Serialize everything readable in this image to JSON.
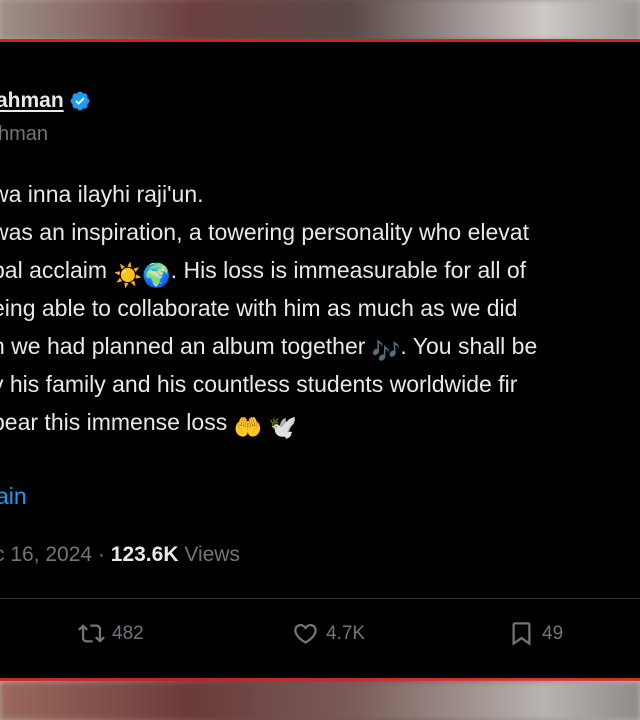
{
  "post": {
    "display_name": "ahman",
    "handle": "hman",
    "lines": [
      {
        "text": "wa inna ilayhi raji'un."
      },
      {
        "text": "was an inspiration, a towering personality who elevat"
      },
      {
        "text": "bal acclaim ",
        "emojis": [
          "☀️",
          "🌍"
        ],
        "after": ". His loss is immeasurable for all of"
      },
      {
        "text": "eing able to collaborate with him as much as we did"
      },
      {
        "text": "n we had planned an album together ",
        "emojis": [
          "🎶"
        ],
        "after": ". You shall be"
      },
      {
        "text": "y his family and his countless students worldwide fir"
      },
      {
        "text": "bear this immense loss ",
        "emojis": [
          "🤲",
          "🕊️"
        ],
        "after": ""
      }
    ],
    "show_more": "ain",
    "date": "c 16, 2024",
    "separator": " · ",
    "views_count": "123.6K",
    "views_label": " Views"
  },
  "actions": {
    "retweets": "482",
    "likes": "4.7K",
    "bookmarks": "49"
  },
  "colors": {
    "background": "#000000",
    "text": "#e7e9ea",
    "muted": "#71767b",
    "link": "#1d9bf0",
    "verified": "#1d9bf0",
    "frame": "#d61f1f"
  },
  "icons": [
    "verified-badge-icon",
    "retweet-icon",
    "heart-icon",
    "bookmark-icon"
  ]
}
